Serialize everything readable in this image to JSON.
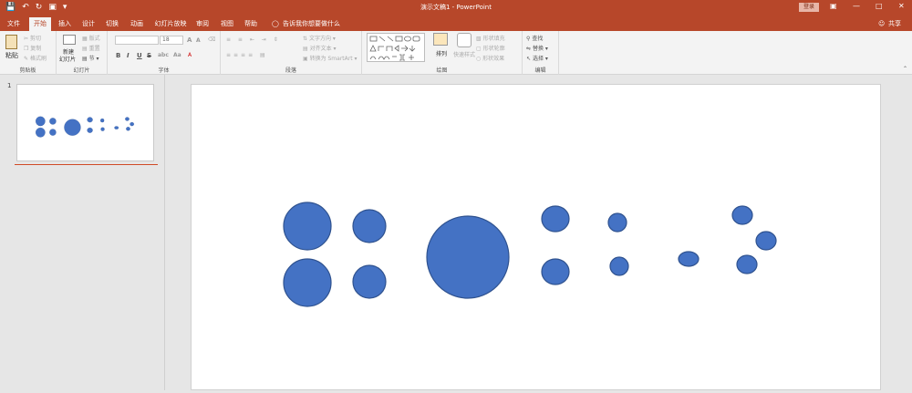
{
  "title_bar": {
    "document_title": "演示文稿1 - PowerPoint",
    "login_label": "登录"
  },
  "tabs": [
    "文件",
    "开始",
    "插入",
    "设计",
    "切换",
    "动画",
    "幻灯片放映",
    "审阅",
    "视图",
    "帮助"
  ],
  "active_tab": "开始",
  "tell_me": "告诉我你想要做什么",
  "share_label": "共享",
  "ribbon": {
    "clipboard": {
      "label": "剪贴板",
      "paste": "粘贴",
      "cut": "剪切",
      "copy": "复制",
      "format_painter": "格式刷"
    },
    "slides": {
      "label": "幻灯片",
      "new_slide_1": "新建",
      "new_slide_2": "幻灯片",
      "layout": "版式",
      "reset": "重置",
      "section": "节"
    },
    "font": {
      "label": "字体",
      "font_name": "",
      "font_size": "18",
      "bold": "B",
      "italic": "I",
      "underline": "U",
      "strike": "S",
      "spacing": "abc",
      "case": "Aa",
      "grow": "A",
      "shrink": "A"
    },
    "paragraph": {
      "label": "段落",
      "text_direction": "文字方向",
      "align_text": "对齐文本",
      "smartart": "转换为 SmartArt"
    },
    "drawing": {
      "label": "绘图",
      "arrange": "排列",
      "quick_styles": "快速样式",
      "shape_fill": "形状填充",
      "shape_outline": "形状轮廓",
      "shape_effects": "形状效果"
    },
    "editing": {
      "label": "编辑",
      "find": "查找",
      "replace": "替换",
      "select": "选择"
    }
  },
  "slide_panel": {
    "slide_number": "1"
  },
  "colors": {
    "accent": "#b7472a",
    "shape_fill": "#4472c4",
    "shape_outline": "#2f528f"
  }
}
